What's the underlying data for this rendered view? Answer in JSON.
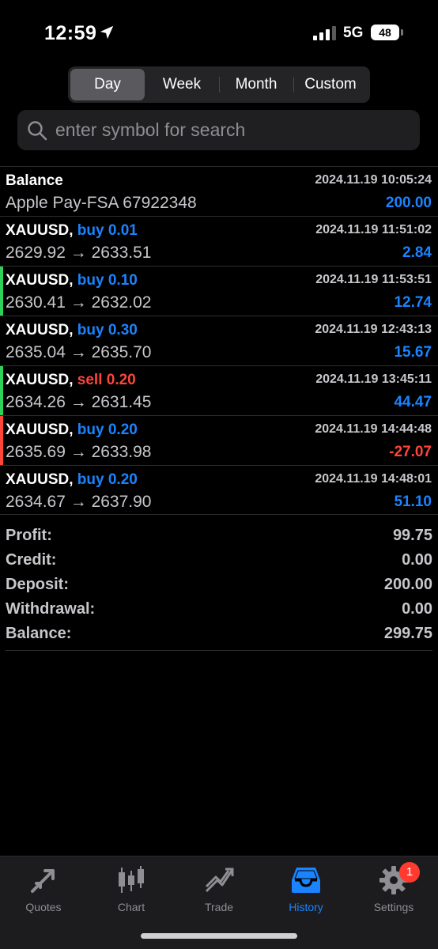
{
  "status": {
    "time": "12:59",
    "network": "5G",
    "battery": "48"
  },
  "periods": [
    {
      "label": "Day",
      "active": true
    },
    {
      "label": "Week",
      "active": false
    },
    {
      "label": "Month",
      "active": false
    },
    {
      "label": "Custom",
      "active": false
    }
  ],
  "search": {
    "placeholder": "enter symbol for search"
  },
  "balance_entry": {
    "title": "Balance",
    "timestamp": "2024.11.19 10:05:24",
    "description": "Apple Pay-FSA 67922348",
    "amount": "200.00"
  },
  "deals": [
    {
      "symbol": "XAUUSD,",
      "side": "buy 0.01",
      "type": "buy",
      "timestamp": "2024.11.19 11:51:02",
      "prices": "2629.92 → 2633.51",
      "profit": "2.84",
      "bar": ""
    },
    {
      "symbol": "XAUUSD,",
      "side": "buy 0.10",
      "type": "buy",
      "timestamp": "2024.11.19 11:53:51",
      "prices": "2630.41 → 2632.02",
      "profit": "12.74",
      "bar": "#30d158"
    },
    {
      "symbol": "XAUUSD,",
      "side": "buy 0.30",
      "type": "buy",
      "timestamp": "2024.11.19 12:43:13",
      "prices": "2635.04 → 2635.70",
      "profit": "15.67",
      "bar": ""
    },
    {
      "symbol": "XAUUSD,",
      "side": "sell 0.20",
      "type": "sell",
      "timestamp": "2024.11.19 13:45:11",
      "prices": "2634.26 → 2631.45",
      "profit": "44.47",
      "bar": "#30d158"
    },
    {
      "symbol": "XAUUSD,",
      "side": "buy 0.20",
      "type": "buy",
      "timestamp": "2024.11.19 14:44:48",
      "prices": "2635.69 → 2633.98",
      "profit": "-27.07",
      "bar": "#ff453a"
    },
    {
      "symbol": "XAUUSD,",
      "side": "buy 0.20",
      "type": "buy",
      "timestamp": "2024.11.19 14:48:01",
      "prices": "2634.67 → 2637.90",
      "profit": "51.10",
      "bar": ""
    }
  ],
  "summary": [
    {
      "label": "Profit:",
      "value": "99.75"
    },
    {
      "label": "Credit:",
      "value": "0.00"
    },
    {
      "label": "Deposit:",
      "value": "200.00"
    },
    {
      "label": "Withdrawal:",
      "value": "0.00"
    },
    {
      "label": "Balance:",
      "value": "299.75"
    }
  ],
  "tabs": [
    {
      "label": "Quotes",
      "icon": "quotes-arrows-icon",
      "active": false
    },
    {
      "label": "Chart",
      "icon": "candlestick-icon",
      "active": false
    },
    {
      "label": "Trade",
      "icon": "trend-icon",
      "active": false
    },
    {
      "label": "History",
      "icon": "inbox-icon",
      "active": true
    },
    {
      "label": "Settings",
      "icon": "gear-icon",
      "active": false,
      "badge": "1"
    }
  ],
  "colors": {
    "buy": "#1a84ff",
    "sell": "#ff453a",
    "accent": "#1a84ff"
  }
}
